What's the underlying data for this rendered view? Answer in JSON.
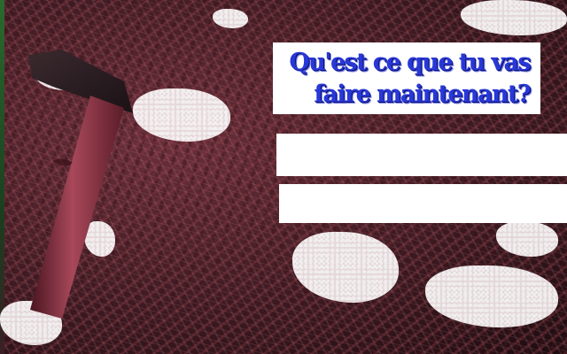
{
  "question": {
    "line1": "Qu'est ce que tu vas",
    "line2": "faire maintenant?"
  },
  "choices": [
    {
      "label": ""
    },
    {
      "label": ""
    }
  ],
  "colors": {
    "question_text": "#2838d8",
    "question_shadow": "#0a0f66",
    "dialog_background": "#ffffff",
    "scene_tone": "#6b2f3a"
  },
  "scene": {
    "description_icon": "axe-in-straw-icon"
  }
}
